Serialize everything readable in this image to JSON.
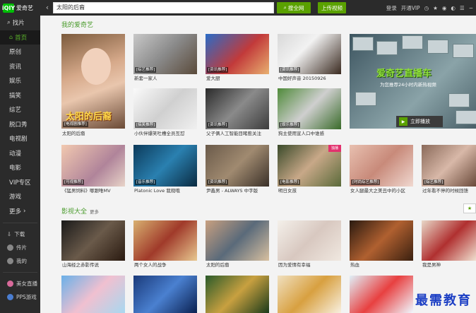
{
  "app": {
    "logo_text": "爱奇艺",
    "logo_mark": "iQIY"
  },
  "search": {
    "value": "太阳的后裔",
    "search_button": "搜全网",
    "upload_button": "上传视频"
  },
  "top_right": {
    "login": "登录",
    "vip": "开通VIP"
  },
  "sidebar": {
    "search_label": "找片",
    "items": [
      "首页",
      "原创",
      "资讯",
      "娱乐",
      "搞笑",
      "综艺",
      "脱口秀",
      "电视剧",
      "动漫",
      "电影",
      "VIP专区",
      "游戏",
      "更多"
    ],
    "bottom": [
      "下载",
      "传片",
      "我的"
    ],
    "extra": [
      "美女直播",
      "PPS游戏"
    ]
  },
  "sections": {
    "my": "我的爱奇艺",
    "movies": "影视大全",
    "more": "更多"
  },
  "hero": {
    "overlay": "太阳的后裔",
    "tag": "[电视剧推荐]",
    "caption": "太阳的后裔"
  },
  "row1": [
    {
      "tag": "[综艺推荐]",
      "caption": "新套一家人"
    },
    {
      "tag": "[资讯推荐]",
      "caption": "爱大厨"
    },
    {
      "tag": "[资讯推荐]",
      "caption": "中国好声音 20150926"
    }
  ],
  "row2": [
    {
      "tag": "[搞笑推荐]",
      "caption": "小伙伴爆笑吐槽全员互怼"
    },
    {
      "tag": "[资讯推荐]",
      "caption": "父子俩人工智能目睹惹关注"
    },
    {
      "tag": "[娱乐推荐]",
      "caption": "狗主使用宣人口中谁感"
    }
  ],
  "banner": {
    "title": "爱奇艺直播车",
    "subtitle": "为您推荐24小时内新热视频",
    "button": "立即播放"
  },
  "row3": [
    {
      "tag": "[可视推荐]",
      "caption": "《猛男饲料》哪跟唯MV"
    },
    {
      "tag": "[音乐推荐]",
      "caption": "Platonic Love 我观哦"
    },
    {
      "tag": "[资讯推荐]",
      "caption": "尹鑫男 - ALWAYS 中字版"
    },
    {
      "tag": "[电影推荐]",
      "caption": "明日女孩",
      "ribbon": "独播"
    },
    {
      "tag": "[时尚综艺推荐]",
      "caption": "女人腿最大之美丑中的小区"
    },
    {
      "tag": "[综艺推荐]",
      "caption": "过年看不停的时候回馈"
    }
  ],
  "row4": [
    {
      "tag": "",
      "caption": "山海经之赤影传说"
    },
    {
      "tag": "",
      "caption": "两个女人的战争"
    },
    {
      "tag": "",
      "caption": "太阳的后裔"
    },
    {
      "tag": "",
      "caption": "因为爱情有幸福"
    },
    {
      "tag": "",
      "caption": "热血"
    },
    {
      "tag": "",
      "caption": "我是男神"
    }
  ],
  "watermark": "最需教育",
  "colors": {
    "accent": "#5aa100",
    "sidebar_bg": "#2b2b2b",
    "section_title": "#4a9b2c",
    "active_item": "#5ab02a"
  }
}
